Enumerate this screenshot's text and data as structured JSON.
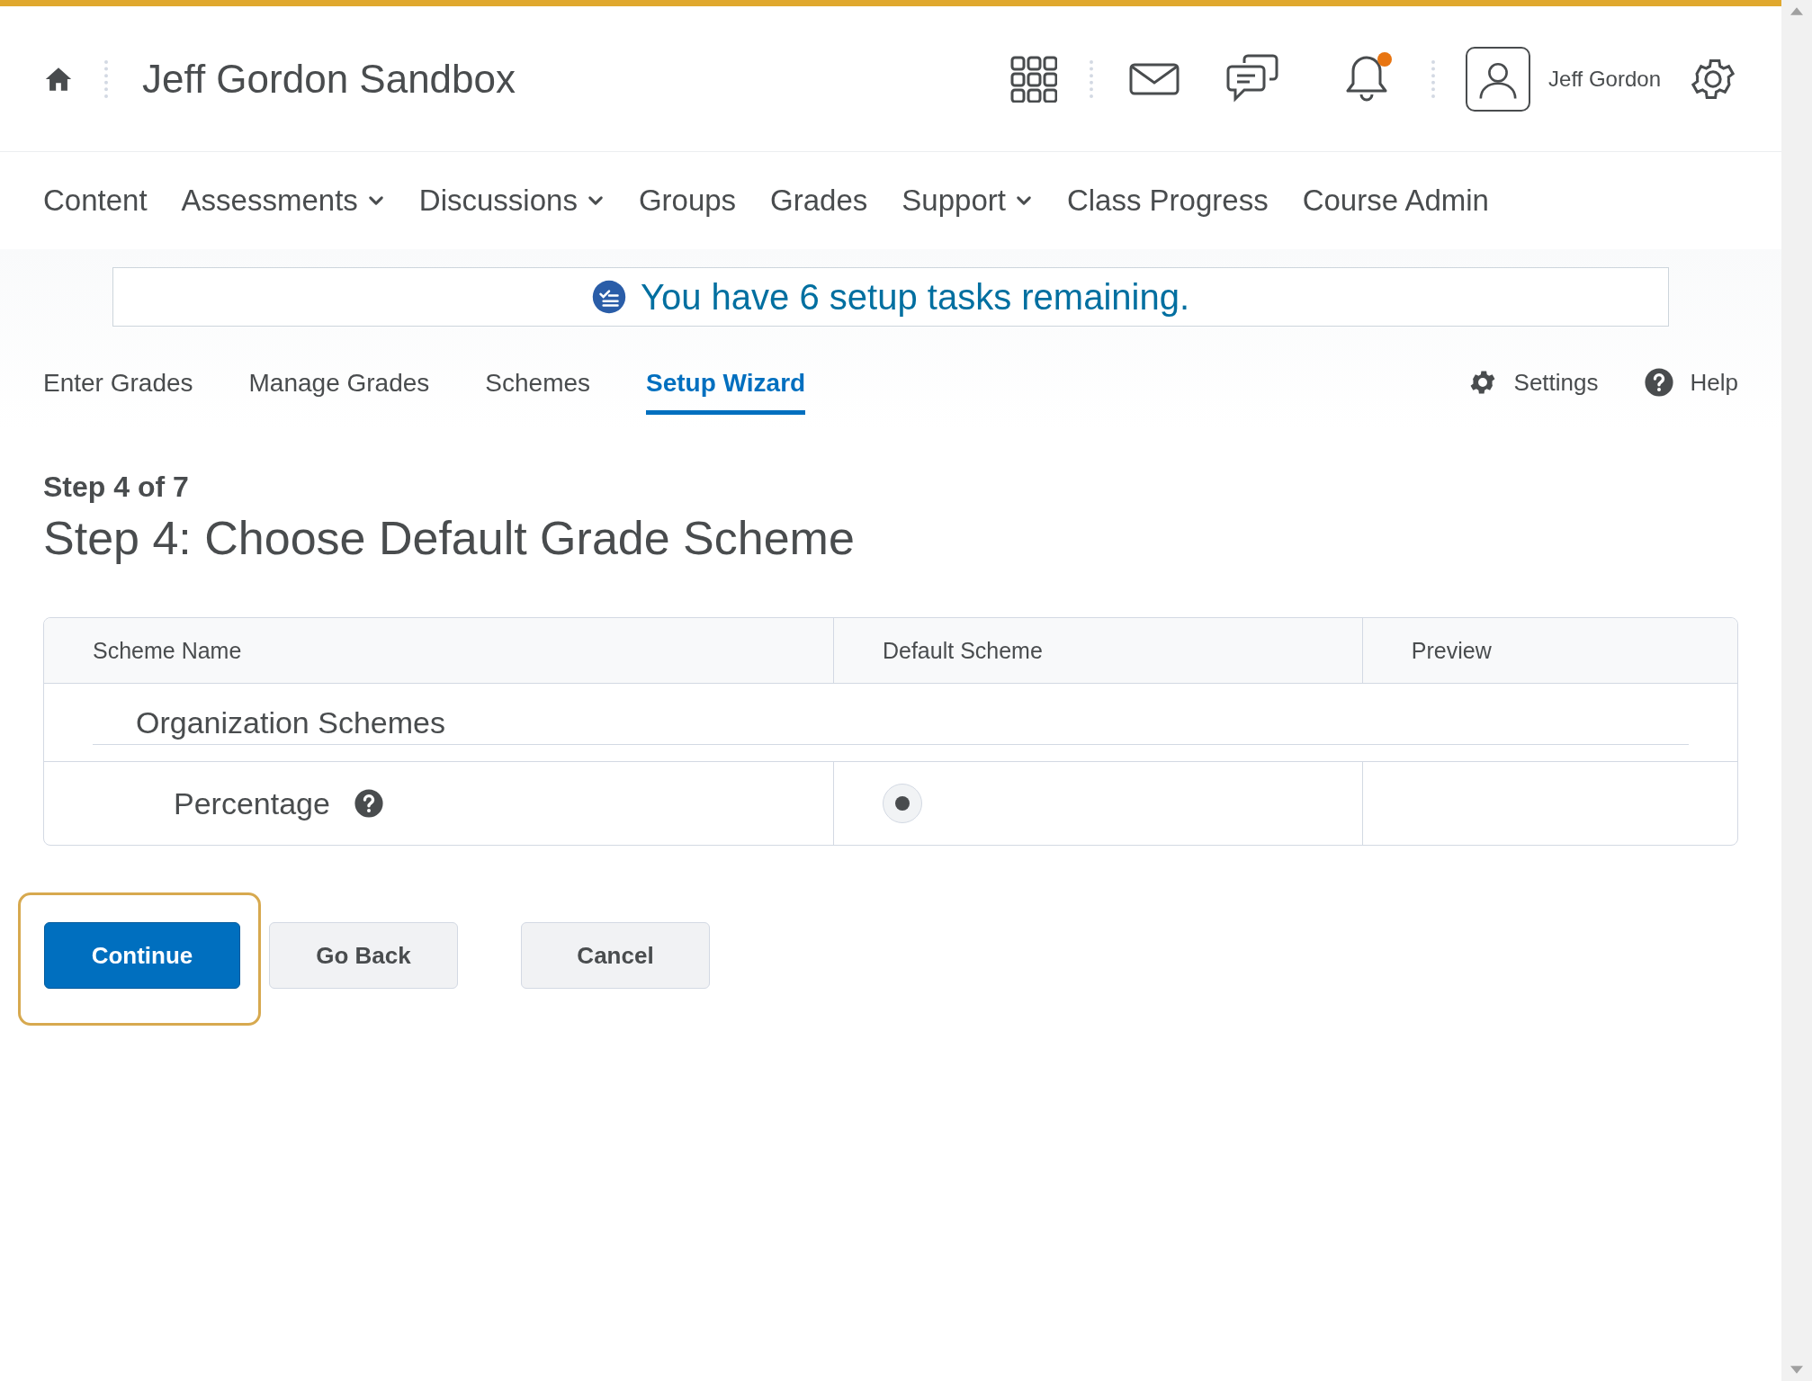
{
  "header": {
    "title": "Jeff Gordon Sandbox",
    "user_name": "Jeff Gordon",
    "notification_unread": true
  },
  "nav": [
    {
      "label": "Content",
      "has_menu": false
    },
    {
      "label": "Assessments",
      "has_menu": true
    },
    {
      "label": "Discussions",
      "has_menu": true
    },
    {
      "label": "Groups",
      "has_menu": false
    },
    {
      "label": "Grades",
      "has_menu": false
    },
    {
      "label": "Support",
      "has_menu": true
    },
    {
      "label": "Class Progress",
      "has_menu": false
    },
    {
      "label": "Course Admin",
      "has_menu": false
    }
  ],
  "alert": {
    "text": "You have 6 setup tasks remaining."
  },
  "tabs": [
    {
      "label": "Enter Grades",
      "selected": false
    },
    {
      "label": "Manage Grades",
      "selected": false
    },
    {
      "label": "Schemes",
      "selected": false
    },
    {
      "label": "Setup Wizard",
      "selected": true
    }
  ],
  "tab_actions": [
    {
      "kind": "settings",
      "label": "Settings"
    },
    {
      "kind": "help",
      "label": "Help"
    }
  ],
  "step": {
    "counter": "Step 4 of 7",
    "heading": "Step 4: Choose Default Grade Scheme"
  },
  "table": {
    "columns": [
      "Scheme Name",
      "Default Scheme",
      "Preview"
    ],
    "groups": [
      {
        "title": "Organization Schemes",
        "rows": [
          {
            "name": "Percentage",
            "has_help": true,
            "selected": true
          }
        ]
      }
    ]
  },
  "buttons": [
    {
      "label": "Continue",
      "kind": "primary",
      "focused": true
    },
    {
      "label": "Go Back",
      "kind": "secondary",
      "focused": false
    },
    {
      "label": "Cancel",
      "kind": "secondary",
      "focused": false
    }
  ]
}
